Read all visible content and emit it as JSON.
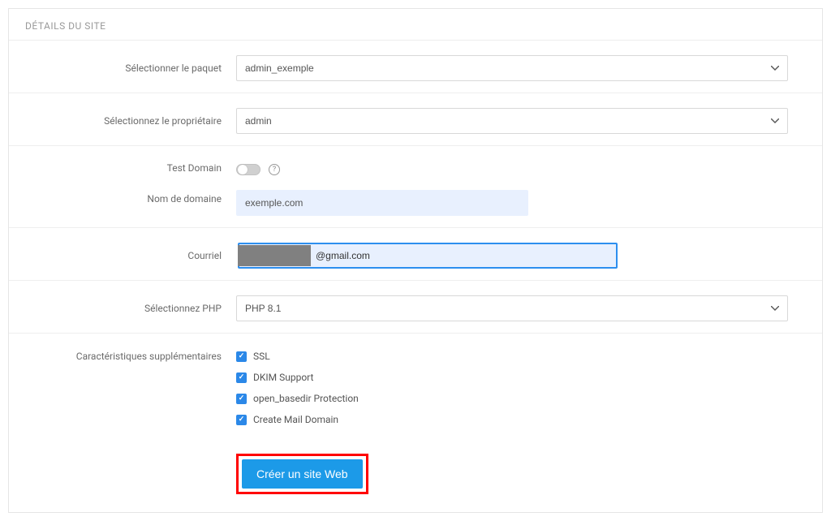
{
  "panel": {
    "title": "DÉTAILS DU SITE"
  },
  "fields": {
    "package": {
      "label": "Sélectionner le paquet",
      "value": "admin_exemple"
    },
    "owner": {
      "label": "Sélectionnez le propriétaire",
      "value": "admin"
    },
    "testDomain": {
      "label": "Test Domain"
    },
    "domain": {
      "label": "Nom de domaine",
      "value": "exemple.com"
    },
    "email": {
      "label": "Courriel",
      "value": "@gmail.com"
    },
    "php": {
      "label": "Sélectionnez PHP",
      "value": "PHP 8.1"
    },
    "features": {
      "label": "Caractéristiques supplémentaires",
      "items": [
        {
          "key": "ssl",
          "label": "SSL",
          "checked": true
        },
        {
          "key": "dkim",
          "label": "DKIM Support",
          "checked": true
        },
        {
          "key": "openbasedir",
          "label": "open_basedir Protection",
          "checked": true
        },
        {
          "key": "maildomain",
          "label": "Create Mail Domain",
          "checked": true
        }
      ]
    }
  },
  "submit": {
    "label": "Créer un site Web"
  }
}
